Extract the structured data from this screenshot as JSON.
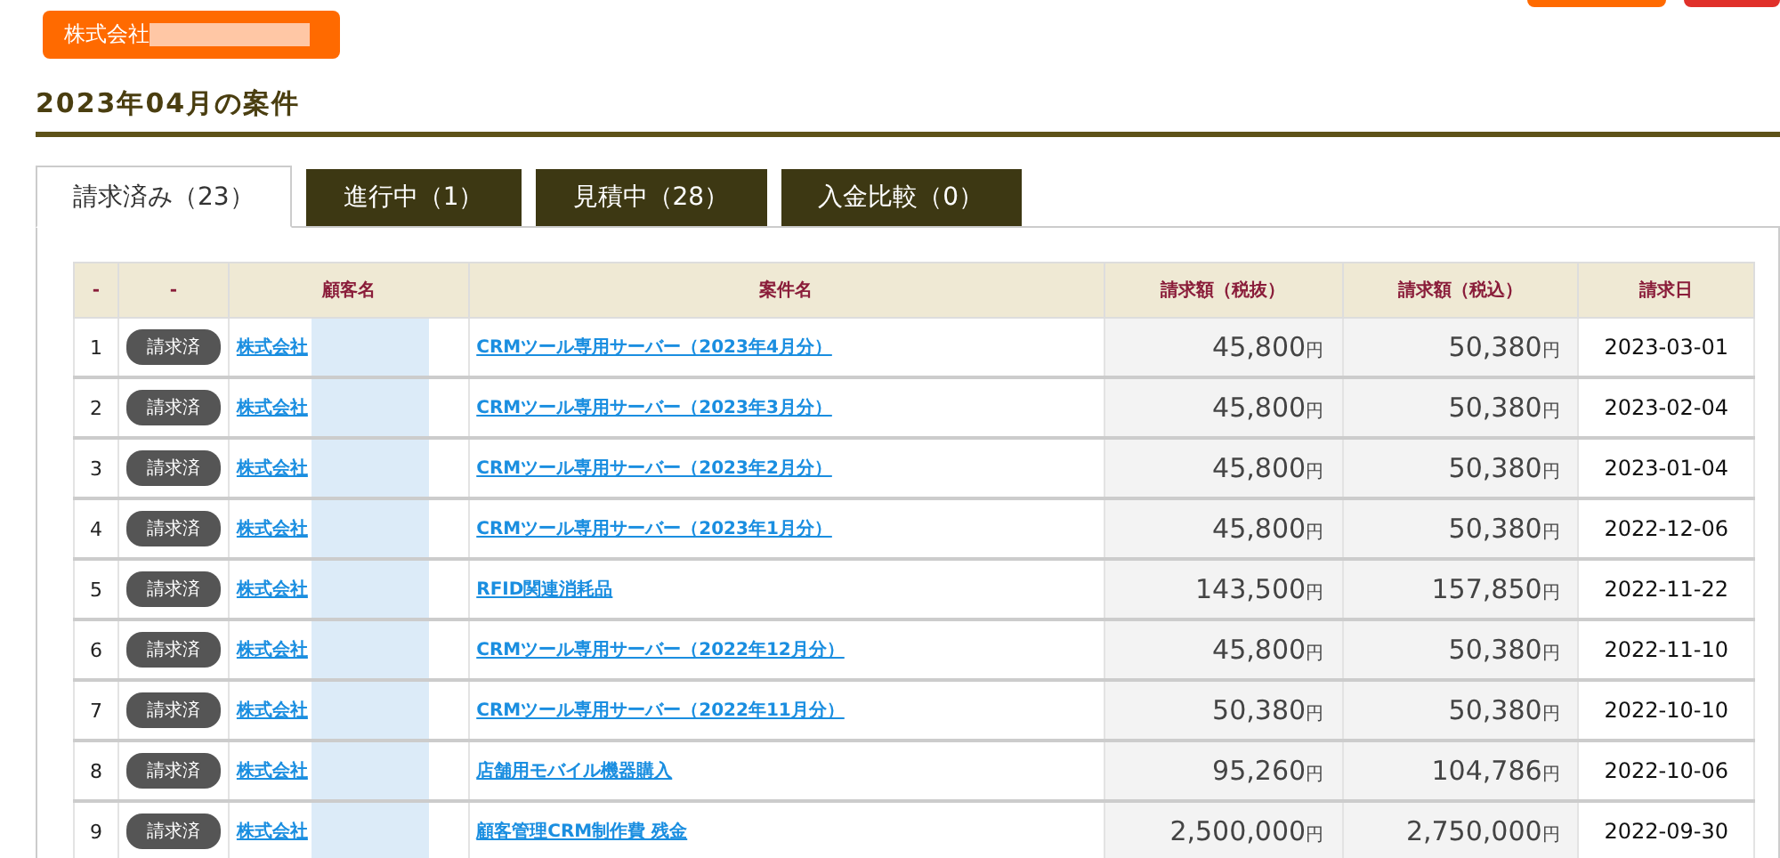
{
  "company_badge": {
    "label": "株式会社"
  },
  "page_title": "2023年04月の案件",
  "tabs": [
    {
      "label": "請求済み（23）",
      "selected": true
    },
    {
      "label": "進行中（1）",
      "selected": false
    },
    {
      "label": "見積中（28）",
      "selected": false
    },
    {
      "label": "入金比較（0）",
      "selected": false
    }
  ],
  "table": {
    "columns": [
      "-",
      "-",
      "顧客名",
      "案件名",
      "請求額（税抜）",
      "請求額（税込）",
      "請求日"
    ],
    "rows": [
      {
        "no": "1",
        "status": "請求済",
        "customer": "株式会社",
        "project": "CRMツール専用サーバー（2023年4月分）",
        "amount_ex": {
          "value": "45,800",
          "unit": "円"
        },
        "amount_in": {
          "value": "50,380",
          "unit": "円"
        },
        "date": "2023-03-01"
      },
      {
        "no": "2",
        "status": "請求済",
        "customer": "株式会社",
        "project": "CRMツール専用サーバー（2023年3月分）",
        "amount_ex": {
          "value": "45,800",
          "unit": "円"
        },
        "amount_in": {
          "value": "50,380",
          "unit": "円"
        },
        "date": "2023-02-04"
      },
      {
        "no": "3",
        "status": "請求済",
        "customer": "株式会社",
        "project": "CRMツール専用サーバー（2023年2月分）",
        "amount_ex": {
          "value": "45,800",
          "unit": "円"
        },
        "amount_in": {
          "value": "50,380",
          "unit": "円"
        },
        "date": "2023-01-04"
      },
      {
        "no": "4",
        "status": "請求済",
        "customer": "株式会社",
        "project": "CRMツール専用サーバー（2023年1月分）",
        "amount_ex": {
          "value": "45,800",
          "unit": "円"
        },
        "amount_in": {
          "value": "50,380",
          "unit": "円"
        },
        "date": "2022-12-06"
      },
      {
        "no": "5",
        "status": "請求済",
        "customer": "株式会社",
        "project": "RFID関連消耗品",
        "amount_ex": {
          "value": "143,500",
          "unit": "円"
        },
        "amount_in": {
          "value": "157,850",
          "unit": "円"
        },
        "date": "2022-11-22"
      },
      {
        "no": "6",
        "status": "請求済",
        "customer": "株式会社",
        "project": "CRMツール専用サーバー（2022年12月分）",
        "amount_ex": {
          "value": "45,800",
          "unit": "円"
        },
        "amount_in": {
          "value": "50,380",
          "unit": "円"
        },
        "date": "2022-11-10"
      },
      {
        "no": "7",
        "status": "請求済",
        "customer": "株式会社",
        "project": "CRMツール専用サーバー（2022年11月分）",
        "amount_ex": {
          "value": "50,380",
          "unit": "円"
        },
        "amount_in": {
          "value": "50,380",
          "unit": "円"
        },
        "date": "2022-10-10"
      },
      {
        "no": "8",
        "status": "請求済",
        "customer": "株式会社",
        "project": "店舗用モバイル機器購入",
        "amount_ex": {
          "value": "95,260",
          "unit": "円"
        },
        "amount_in": {
          "value": "104,786",
          "unit": "円"
        },
        "date": "2022-10-06"
      },
      {
        "no": "9",
        "status": "請求済",
        "customer": "株式会社",
        "project": "顧客管理CRM制作費 残金",
        "amount_ex": {
          "value": "2,500,000",
          "unit": "円"
        },
        "amount_in": {
          "value": "2,750,000",
          "unit": "円"
        },
        "date": "2022-09-30"
      }
    ]
  }
}
